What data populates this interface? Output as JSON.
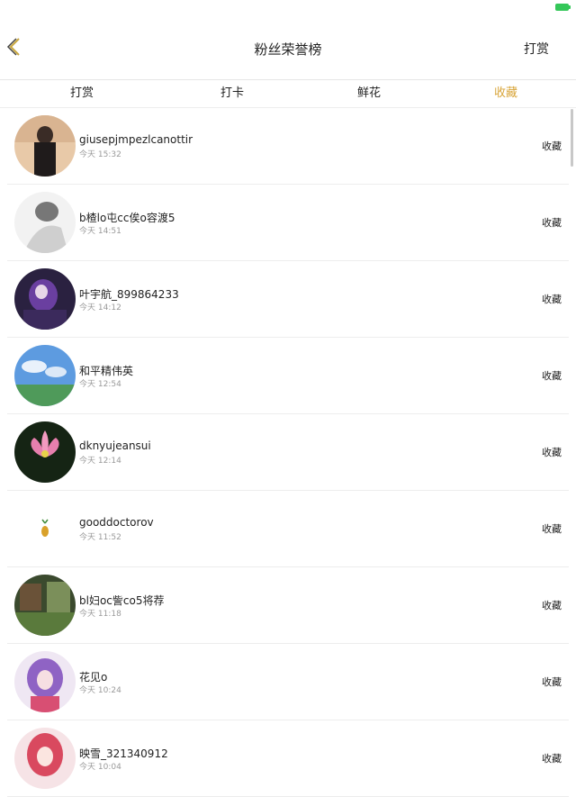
{
  "header": {
    "title": "粉丝荣誉榜",
    "right_action": "打赏"
  },
  "tabs": [
    {
      "label": "打赏"
    },
    {
      "label": "打卡"
    },
    {
      "label": "鲜花"
    },
    {
      "label": "收藏",
      "active": true
    }
  ],
  "items": [
    {
      "name": "giusepjmpezlcanottir",
      "time": "今天 15:32",
      "action": "收藏"
    },
    {
      "name": "b楂lo屯cc俟o容渡5",
      "time": "今天 14:51",
      "action": "收藏"
    },
    {
      "name": "叶宇航_899864233",
      "time": "今天 14:12",
      "action": "收藏"
    },
    {
      "name": "和平精伟英",
      "time": "今天 12:54",
      "action": "收藏"
    },
    {
      "name": "dknyujeansui",
      "time": "今天 12:14",
      "action": "收藏"
    },
    {
      "name": "gooddoctorov",
      "time": "今天 11:52",
      "action": "收藏"
    },
    {
      "name": "bl妇oc訾co5将荐",
      "time": "今天 11:18",
      "action": "收藏"
    },
    {
      "name": "花见o",
      "time": "今天 10:24",
      "action": "收藏"
    },
    {
      "name": "映雪_321340912",
      "time": "今天 10:04",
      "action": "收藏"
    }
  ],
  "colors": {
    "accent": "#d8a53a",
    "text": "#222222",
    "subtext": "#9a9a9a",
    "divider": "#ededed"
  }
}
